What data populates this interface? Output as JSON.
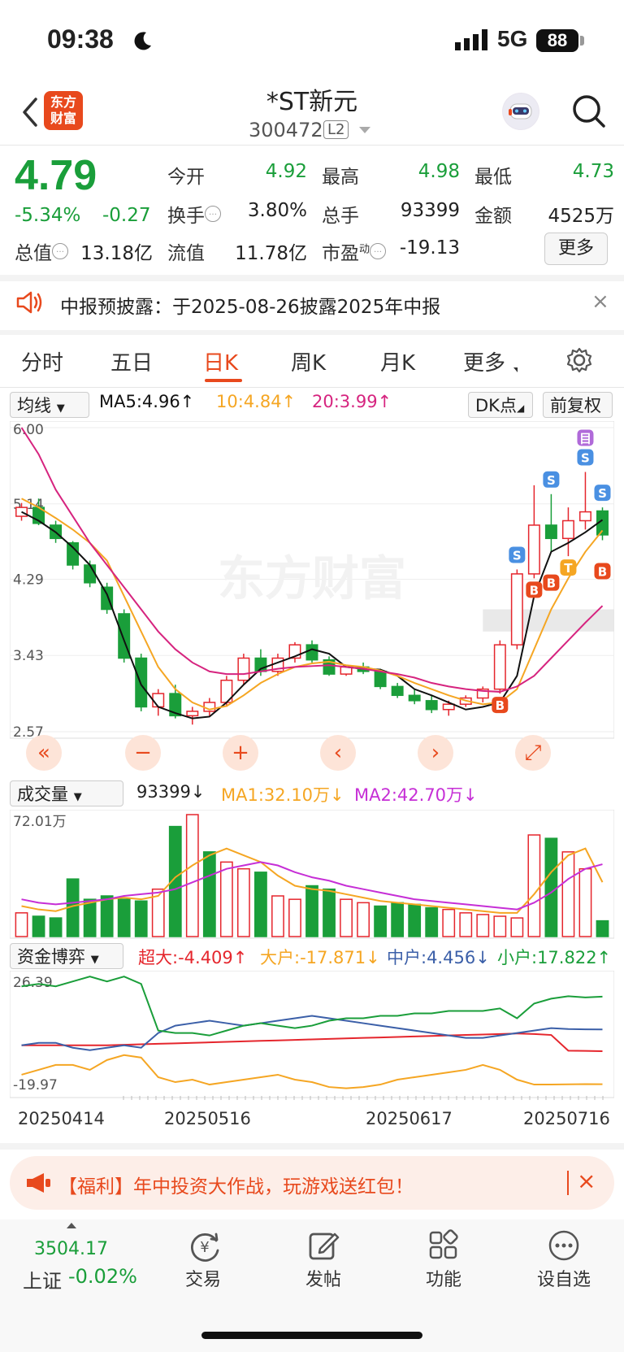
{
  "status": {
    "time": "09:38",
    "network": "5G",
    "battery": "88"
  },
  "header": {
    "logo": "东方财富",
    "logo_line1": "东方",
    "logo_line2": "财富",
    "name": "*ST新元",
    "code": "300472",
    "badge": "L2"
  },
  "quote": {
    "price": "4.79",
    "pct": "-5.34%",
    "change": "-0.27",
    "cells": [
      {
        "label": "今开",
        "value": "4.92"
      },
      {
        "label": "最高",
        "value": "4.98"
      },
      {
        "label": "最低",
        "value": "4.73"
      },
      {
        "label": "换手",
        "value": "3.80%"
      },
      {
        "label": "总手",
        "value": "93399"
      },
      {
        "label": "金额",
        "value": "4525万"
      },
      {
        "label": "总值",
        "value": "13.18亿"
      },
      {
        "label": "流值",
        "value": "11.78亿"
      },
      {
        "label": "市盈",
        "sup": "动",
        "value": "-19.13"
      }
    ],
    "more": "更多"
  },
  "notice": {
    "text": "中报预披露：于2025-08-26披露2025年中报",
    "close": "×"
  },
  "tabs": {
    "items": [
      "分时",
      "五日",
      "日K",
      "周K",
      "月K",
      "更多"
    ],
    "active": "日K"
  },
  "ma": {
    "selector": "均线",
    "ma5": "MA5:4.96↑",
    "ma10": "10:4.84↑",
    "ma20": "20:3.99↑",
    "dk": "DK点",
    "fq": "前复权"
  },
  "colors": {
    "up": "#e5262d",
    "down": "#1a9e3a",
    "accent": "#e8491d",
    "ma5": "#111111",
    "ma10": "#f5a623",
    "ma20": "#d6247f"
  },
  "chart_data": [
    {
      "type": "candlestick",
      "title": "日K",
      "y_ticks": [
        "6.00",
        "5.14",
        "4.29",
        "3.43",
        "2.57"
      ],
      "ylim": [
        2.57,
        6.0
      ],
      "x_ticks": [
        "20250414",
        "20250516",
        "20250617",
        "20250716"
      ],
      "series": [
        {
          "name": "MA5",
          "values": [
            5.05,
            4.95,
            4.82,
            4.65,
            4.45,
            4.12,
            3.6,
            3.1,
            2.85,
            2.78,
            2.72,
            2.74,
            2.9,
            3.1,
            3.28,
            3.35,
            3.42,
            3.5,
            3.45,
            3.3,
            3.28,
            3.27,
            3.2,
            3.05,
            2.98,
            2.9,
            2.82,
            2.85,
            2.9,
            3.2,
            4.1,
            4.6,
            4.7,
            4.82,
            4.96
          ]
        },
        {
          "name": "MA10",
          "values": [
            5.2,
            5.1,
            4.98,
            4.85,
            4.7,
            4.5,
            4.1,
            3.7,
            3.3,
            3.05,
            2.9,
            2.82,
            2.86,
            2.98,
            3.12,
            3.22,
            3.3,
            3.34,
            3.36,
            3.32,
            3.3,
            3.26,
            3.2,
            3.12,
            3.05,
            2.98,
            2.92,
            2.88,
            2.9,
            3.05,
            3.5,
            3.95,
            4.3,
            4.6,
            4.84
          ]
        },
        {
          "name": "MA20",
          "values": [
            6.0,
            5.7,
            5.3,
            5.0,
            4.7,
            4.45,
            4.2,
            3.95,
            3.7,
            3.5,
            3.35,
            3.25,
            3.22,
            3.22,
            3.25,
            3.28,
            3.3,
            3.31,
            3.32,
            3.3,
            3.28,
            3.25,
            3.22,
            3.18,
            3.12,
            3.08,
            3.05,
            3.03,
            3.02,
            3.08,
            3.2,
            3.4,
            3.6,
            3.8,
            3.99
          ]
        }
      ],
      "candles": [
        [
          5.0,
          5.15,
          4.95,
          5.1
        ],
        [
          5.1,
          5.2,
          4.9,
          4.92
        ],
        [
          4.9,
          4.95,
          4.7,
          4.75
        ],
        [
          4.7,
          4.72,
          4.4,
          4.45
        ],
        [
          4.45,
          4.5,
          4.2,
          4.25
        ],
        [
          4.2,
          4.25,
          3.9,
          3.95
        ],
        [
          3.9,
          3.95,
          3.35,
          3.4
        ],
        [
          3.4,
          3.45,
          2.8,
          2.85
        ],
        [
          2.85,
          3.05,
          2.75,
          3.0
        ],
        [
          3.0,
          3.1,
          2.72,
          2.75
        ],
        [
          2.75,
          2.85,
          2.65,
          2.8
        ],
        [
          2.8,
          2.95,
          2.75,
          2.9
        ],
        [
          2.9,
          3.2,
          2.85,
          3.15
        ],
        [
          3.15,
          3.45,
          3.1,
          3.4
        ],
        [
          3.4,
          3.5,
          3.2,
          3.25
        ],
        [
          3.25,
          3.45,
          3.2,
          3.4
        ],
        [
          3.4,
          3.58,
          3.35,
          3.55
        ],
        [
          3.55,
          3.6,
          3.35,
          3.38
        ],
        [
          3.38,
          3.42,
          3.2,
          3.22
        ],
        [
          3.22,
          3.32,
          3.2,
          3.3
        ],
        [
          3.3,
          3.35,
          3.22,
          3.25
        ],
        [
          3.25,
          3.28,
          3.05,
          3.08
        ],
        [
          3.08,
          3.12,
          2.95,
          2.98
        ],
        [
          2.98,
          3.05,
          2.88,
          2.92
        ],
        [
          2.92,
          2.98,
          2.78,
          2.82
        ],
        [
          2.82,
          2.92,
          2.75,
          2.88
        ],
        [
          2.88,
          2.98,
          2.85,
          2.95
        ],
        [
          2.95,
          3.08,
          2.9,
          3.05
        ],
        [
          3.05,
          3.6,
          3.0,
          3.55
        ],
        [
          3.55,
          4.4,
          3.5,
          4.35
        ],
        [
          4.35,
          5.35,
          4.3,
          4.9
        ],
        [
          4.9,
          5.25,
          4.6,
          4.75
        ],
        [
          4.75,
          5.1,
          4.55,
          4.95
        ],
        [
          4.95,
          5.5,
          4.85,
          5.05
        ],
        [
          5.06,
          5.1,
          4.73,
          4.79
        ]
      ],
      "markers": [
        {
          "label": "S",
          "index": 29,
          "color": "#4a90e2"
        },
        {
          "label": "B",
          "index": 28,
          "color": "#e8491d"
        },
        {
          "label": "B",
          "index": 30,
          "color": "#e8491d"
        },
        {
          "label": "S",
          "index": 31,
          "color": "#4a90e2"
        },
        {
          "label": "B",
          "index": 31,
          "color": "#e8491d"
        },
        {
          "label": "T",
          "index": 32,
          "color": "#f5a623"
        },
        {
          "label": "S",
          "index": 33,
          "color": "#4a90e2"
        },
        {
          "label": "目",
          "index": 33,
          "color": "#b06ad9"
        },
        {
          "label": "S",
          "index": 34,
          "color": "#4a90e2"
        },
        {
          "label": "B",
          "index": 34,
          "color": "#e8491d"
        }
      ]
    },
    {
      "type": "bar",
      "title": "成交量",
      "y_ticks": [
        "72.01万"
      ],
      "ylim": [
        0,
        72.01
      ],
      "legend": {
        "selector": "成交量",
        "vol": "93399↓",
        "ma1": "MA1:32.10万↓",
        "ma2": "MA2:42.70万↓"
      },
      "values": [
        14,
        12,
        11,
        34,
        22,
        24,
        22,
        21,
        28,
        65,
        72,
        50,
        44,
        40,
        38,
        24,
        22,
        30,
        28,
        22,
        20,
        18,
        20,
        19,
        17,
        16,
        14,
        13,
        12,
        11,
        60,
        58,
        50,
        40,
        9.3
      ],
      "up": [
        1,
        0,
        0,
        0,
        0,
        0,
        0,
        0,
        1,
        0,
        1,
        0,
        1,
        1,
        0,
        1,
        1,
        0,
        0,
        1,
        1,
        0,
        0,
        0,
        0,
        1,
        1,
        1,
        1,
        1,
        1,
        0,
        1,
        1,
        0
      ],
      "series": [
        {
          "name": "MA1",
          "values": [
            18,
            16,
            15,
            18,
            20,
            22,
            23,
            22,
            24,
            35,
            42,
            48,
            52,
            48,
            44,
            36,
            30,
            28,
            27,
            25,
            23,
            21,
            20,
            19,
            18,
            17,
            16,
            15,
            14,
            14,
            25,
            38,
            48,
            52,
            32.1
          ]
        },
        {
          "name": "MA2",
          "values": [
            22,
            20,
            19,
            20,
            21,
            22,
            24,
            25,
            26,
            28,
            32,
            36,
            40,
            42,
            44,
            42,
            38,
            35,
            33,
            30,
            28,
            26,
            24,
            22,
            21,
            20,
            19,
            18,
            17,
            16,
            20,
            26,
            34,
            40,
            42.7
          ]
        }
      ]
    },
    {
      "type": "line",
      "title": "资金博弈",
      "y_ticks": [
        "26.39",
        "-19.97"
      ],
      "ylim": [
        -19.97,
        26.39
      ],
      "legend": {
        "selector": "资金博弈",
        "super": "超大:-4.409↑",
        "big": "大户:-17.871↓",
        "mid": "中户:4.456↓",
        "small": "小户:17.822↑"
      },
      "series": [
        {
          "name": "超大",
          "color": "#e5262d",
          "values": [
            -2,
            -2,
            -2,
            -2,
            -2,
            -2,
            -1.8,
            -1.6,
            -1.4,
            -1.2,
            -1,
            -0.8,
            -0.6,
            -0.4,
            -0.2,
            0,
            0.2,
            0.4,
            0.6,
            0.8,
            1,
            1.2,
            1.4,
            1.6,
            1.8,
            2,
            2.2,
            2.4,
            2.6,
            2.8,
            2.6,
            2.2,
            -4.2,
            -4.3,
            -4.409
          ]
        },
        {
          "name": "大户",
          "color": "#f5a623",
          "values": [
            -14,
            -12,
            -10,
            -10,
            -12,
            -8,
            -6,
            -7,
            -15,
            -17,
            -16,
            -18,
            -17,
            -16,
            -15,
            -14,
            -16,
            -17,
            -19,
            -19.5,
            -19,
            -18,
            -16,
            -15,
            -14,
            -13,
            -12,
            -10,
            -12,
            -16,
            -18,
            -18,
            -17.9,
            -17.8,
            -17.871
          ]
        },
        {
          "name": "中户",
          "color": "#3b5fa8",
          "values": [
            -2,
            -1,
            -1,
            -3,
            -4,
            -3,
            -2,
            -3,
            3,
            6,
            7,
            8,
            7,
            6,
            7,
            8,
            9,
            10,
            9,
            8,
            7,
            6,
            5,
            4,
            3,
            2,
            1,
            1,
            2,
            3,
            4,
            5,
            4.6,
            4.5,
            4.456
          ]
        },
        {
          "name": "小户",
          "color": "#1a9e3a",
          "values": [
            22,
            23,
            22,
            24,
            26,
            24,
            26,
            23,
            4,
            3,
            3,
            2,
            4,
            6,
            7,
            6,
            5,
            6,
            8,
            9,
            9,
            10,
            10,
            11,
            11,
            12,
            12,
            12,
            13,
            9,
            15,
            17,
            18,
            17.5,
            17.822
          ]
        }
      ]
    }
  ],
  "controls": {
    "fast_back": "«",
    "minus": "−",
    "plus": "+",
    "prev": "‹",
    "next": "›",
    "expand": "⤢"
  },
  "promo": {
    "text": "【福利】年中投资大作战，玩游戏送红包！",
    "close": "×"
  },
  "bottom": {
    "index_value": "3504.17",
    "index_name": "上证",
    "index_pct": "-0.02%",
    "nav": [
      "交易",
      "发帖",
      "功能",
      "设自选"
    ]
  }
}
